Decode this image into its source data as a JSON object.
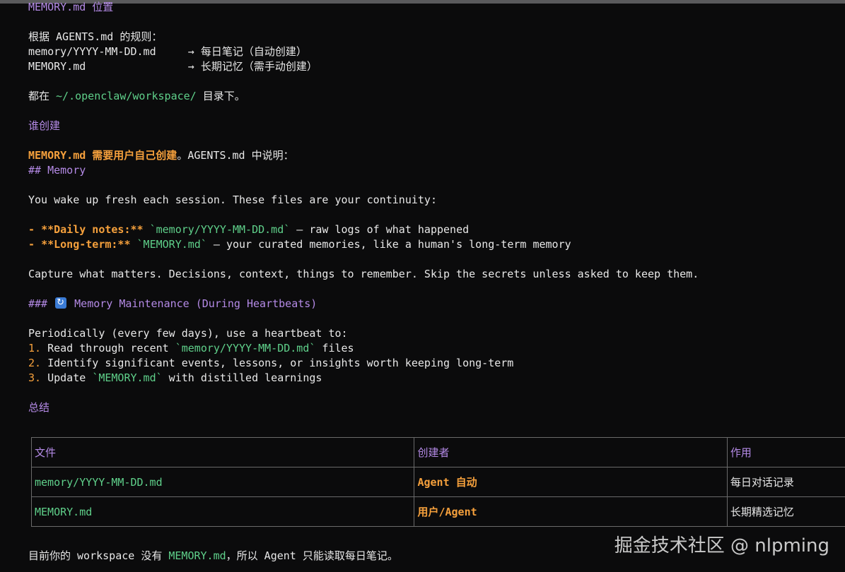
{
  "lines": {
    "h_location": "MEMORY.md 位置",
    "rules_intro": "根据 AGENTS.md 的规则：",
    "rule1_file": "memory/YYYY-MM-DD.md",
    "rule1_desc": "     → 每日笔记（自动创建）",
    "rule2_file": "MEMORY.md",
    "rule2_desc": "                → 长期记忆（需手动创建）",
    "dir_prefix": "都在 ",
    "dir_path": "~/.openclaw/workspace/",
    "dir_suffix": " 目录下。",
    "h_who": "谁创建",
    "who_bold": "MEMORY.md 需要用户自己创建",
    "who_rest": "。AGENTS.md 中说明：",
    "md_heading": "## Memory",
    "wake": "You wake up fresh each session. These files are your continuity:",
    "b1_marker": "- ",
    "b1_label": "**Daily notes:**",
    "b1_code": " `memory/YYYY-MM-DD.md`",
    "b1_rest": " — raw logs of what happened",
    "b2_marker": "- ",
    "b2_label": "**Long-term:**",
    "b2_code": " `MEMORY.md`",
    "b2_rest": " — your curated memories, like a human's long-term memory",
    "capture": "Capture what matters. Decisions, context, things to remember. Skip the secrets unless asked to keep them.",
    "h3_prefix": "###",
    "h3_text": "Memory Maintenance (During Heartbeats)",
    "periodic": "Periodically (every few days), use a heartbeat to:",
    "n1_num": "1.",
    "n1_pre": " Read through recent ",
    "n1_code": "`memory/YYYY-MM-DD.md`",
    "n1_post": " files",
    "n2_num": "2.",
    "n2_text": " Identify significant events, lessons, or insights worth keeping long-term",
    "n3_num": "3.",
    "n3_pre": " Update ",
    "n3_code": "`MEMORY.md`",
    "n3_post": " with distilled learnings",
    "h_summary": "总结",
    "footer_pre": "目前你的 workspace 没有 ",
    "footer_code": "MEMORY.md",
    "footer_post": "，所以 Agent 只能读取每日笔记。"
  },
  "table": {
    "headers": [
      "文件",
      "创建者",
      "作用"
    ],
    "rows": [
      [
        "memory/YYYY-MM-DD.md",
        "Agent 自动",
        "每日对话记录"
      ],
      [
        "MEMORY.md",
        "用户/Agent",
        "长期精选记忆"
      ]
    ]
  },
  "icons": {
    "heading_emoji": "refresh-icon"
  },
  "watermark": "掘金技术社区 @ nlpming",
  "colors": {
    "background": "#0b0b0c",
    "heading": "#b48ae6",
    "bold": "#f5a03c",
    "code": "#5fd08a",
    "text": "#e8e8e8"
  }
}
